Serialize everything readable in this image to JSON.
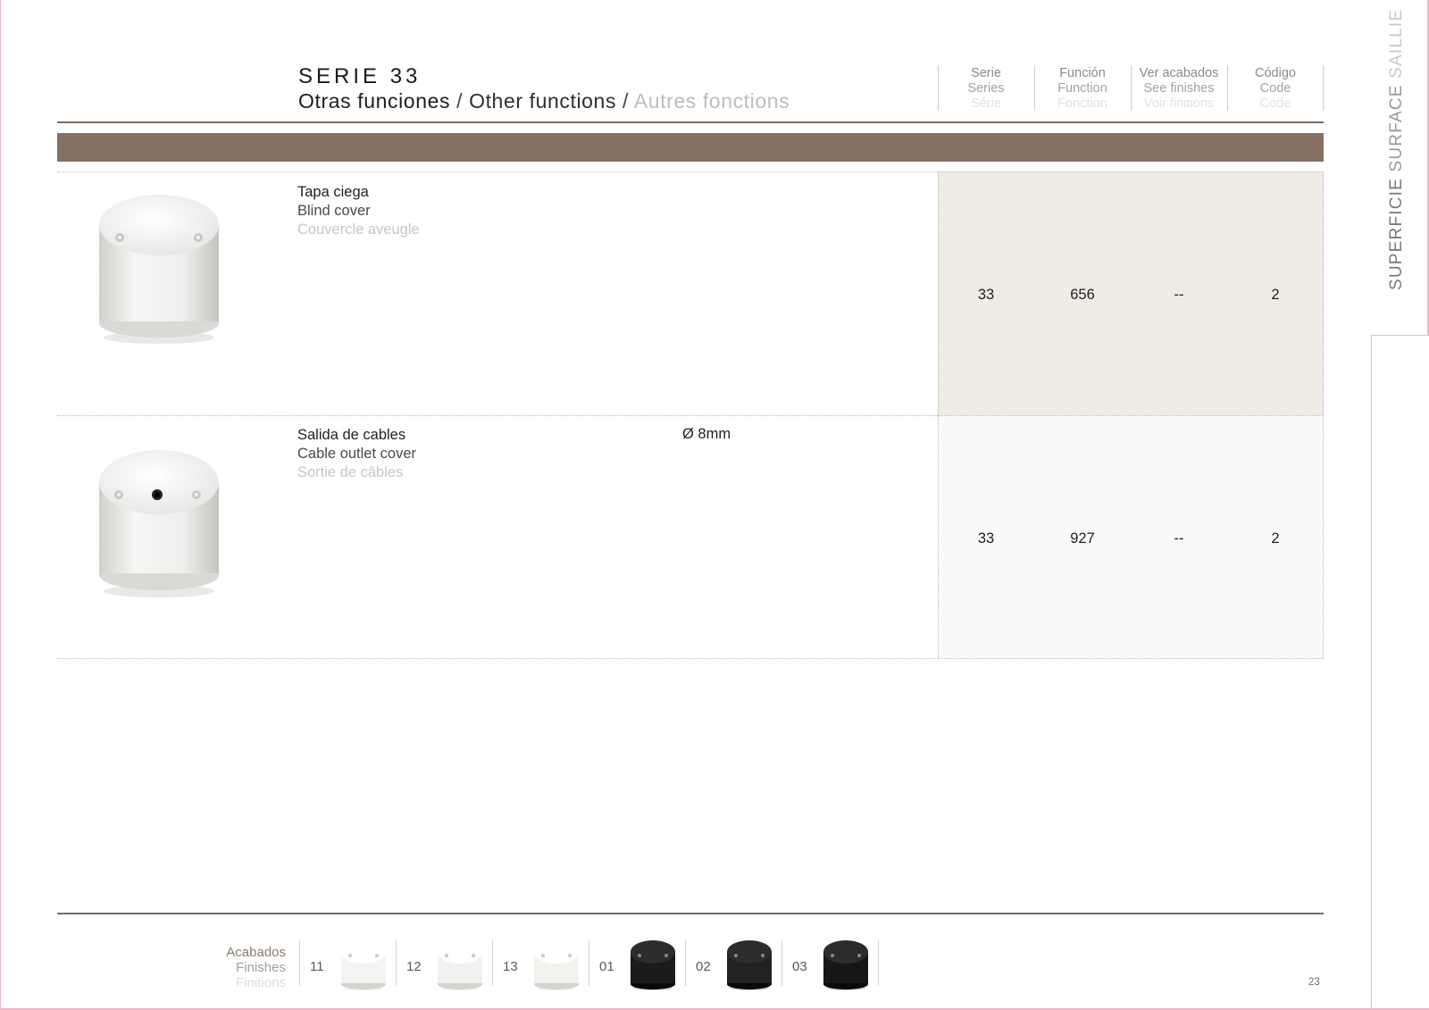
{
  "header": {
    "title": "SERIE 33",
    "subtitle_es": "Otras funciones",
    "subtitle_en": "Other functions",
    "subtitle_fr": "Autres fonctions",
    "separator": " / "
  },
  "side_tab": {
    "es": "SUPERFICIE",
    "en": "SURFACE",
    "fr": "SAILLIE"
  },
  "columns": [
    {
      "es": "Serie",
      "en": "Series",
      "fr": "Série"
    },
    {
      "es": "Función",
      "en": "Function",
      "fr": "Fonction"
    },
    {
      "es": "Ver acabados",
      "en": "See finishes",
      "fr": "Voir finitions"
    },
    {
      "es": "Código",
      "en": "Code",
      "fr": "Code"
    }
  ],
  "products": [
    {
      "name_es": "Tapa ciega",
      "name_en": "Blind cover",
      "name_fr": "Couvercle aveugle",
      "spec": "",
      "image": "blind-cover-product",
      "serie": "33",
      "funcion": "656",
      "acabados": "--",
      "codigo": "2"
    },
    {
      "name_es": "Salida de cables",
      "name_en": "Cable outlet cover",
      "name_fr": "Sortie de câbles",
      "spec": "Ø 8mm",
      "image": "cable-outlet-product",
      "serie": "33",
      "funcion": "927",
      "acabados": "--",
      "codigo": "2"
    }
  ],
  "finishes": {
    "label_es": "Acabados",
    "label_en": "Finishes",
    "label_fr": "Finitions",
    "items": [
      {
        "code": "11",
        "color": "#f4f4f2"
      },
      {
        "code": "12",
        "color": "#f1f1ef"
      },
      {
        "code": "13",
        "color": "#f3f2ee"
      },
      {
        "code": "01",
        "color": "#1b1b1b"
      },
      {
        "code": "02",
        "color": "#222222"
      },
      {
        "code": "03",
        "color": "#161616"
      }
    ]
  },
  "page_number": "23",
  "colors": {
    "band": "#857061",
    "row1_bg": "#f0ebe4",
    "row2_bg": "#fbfaf8",
    "frame": "#e9b9c8"
  }
}
